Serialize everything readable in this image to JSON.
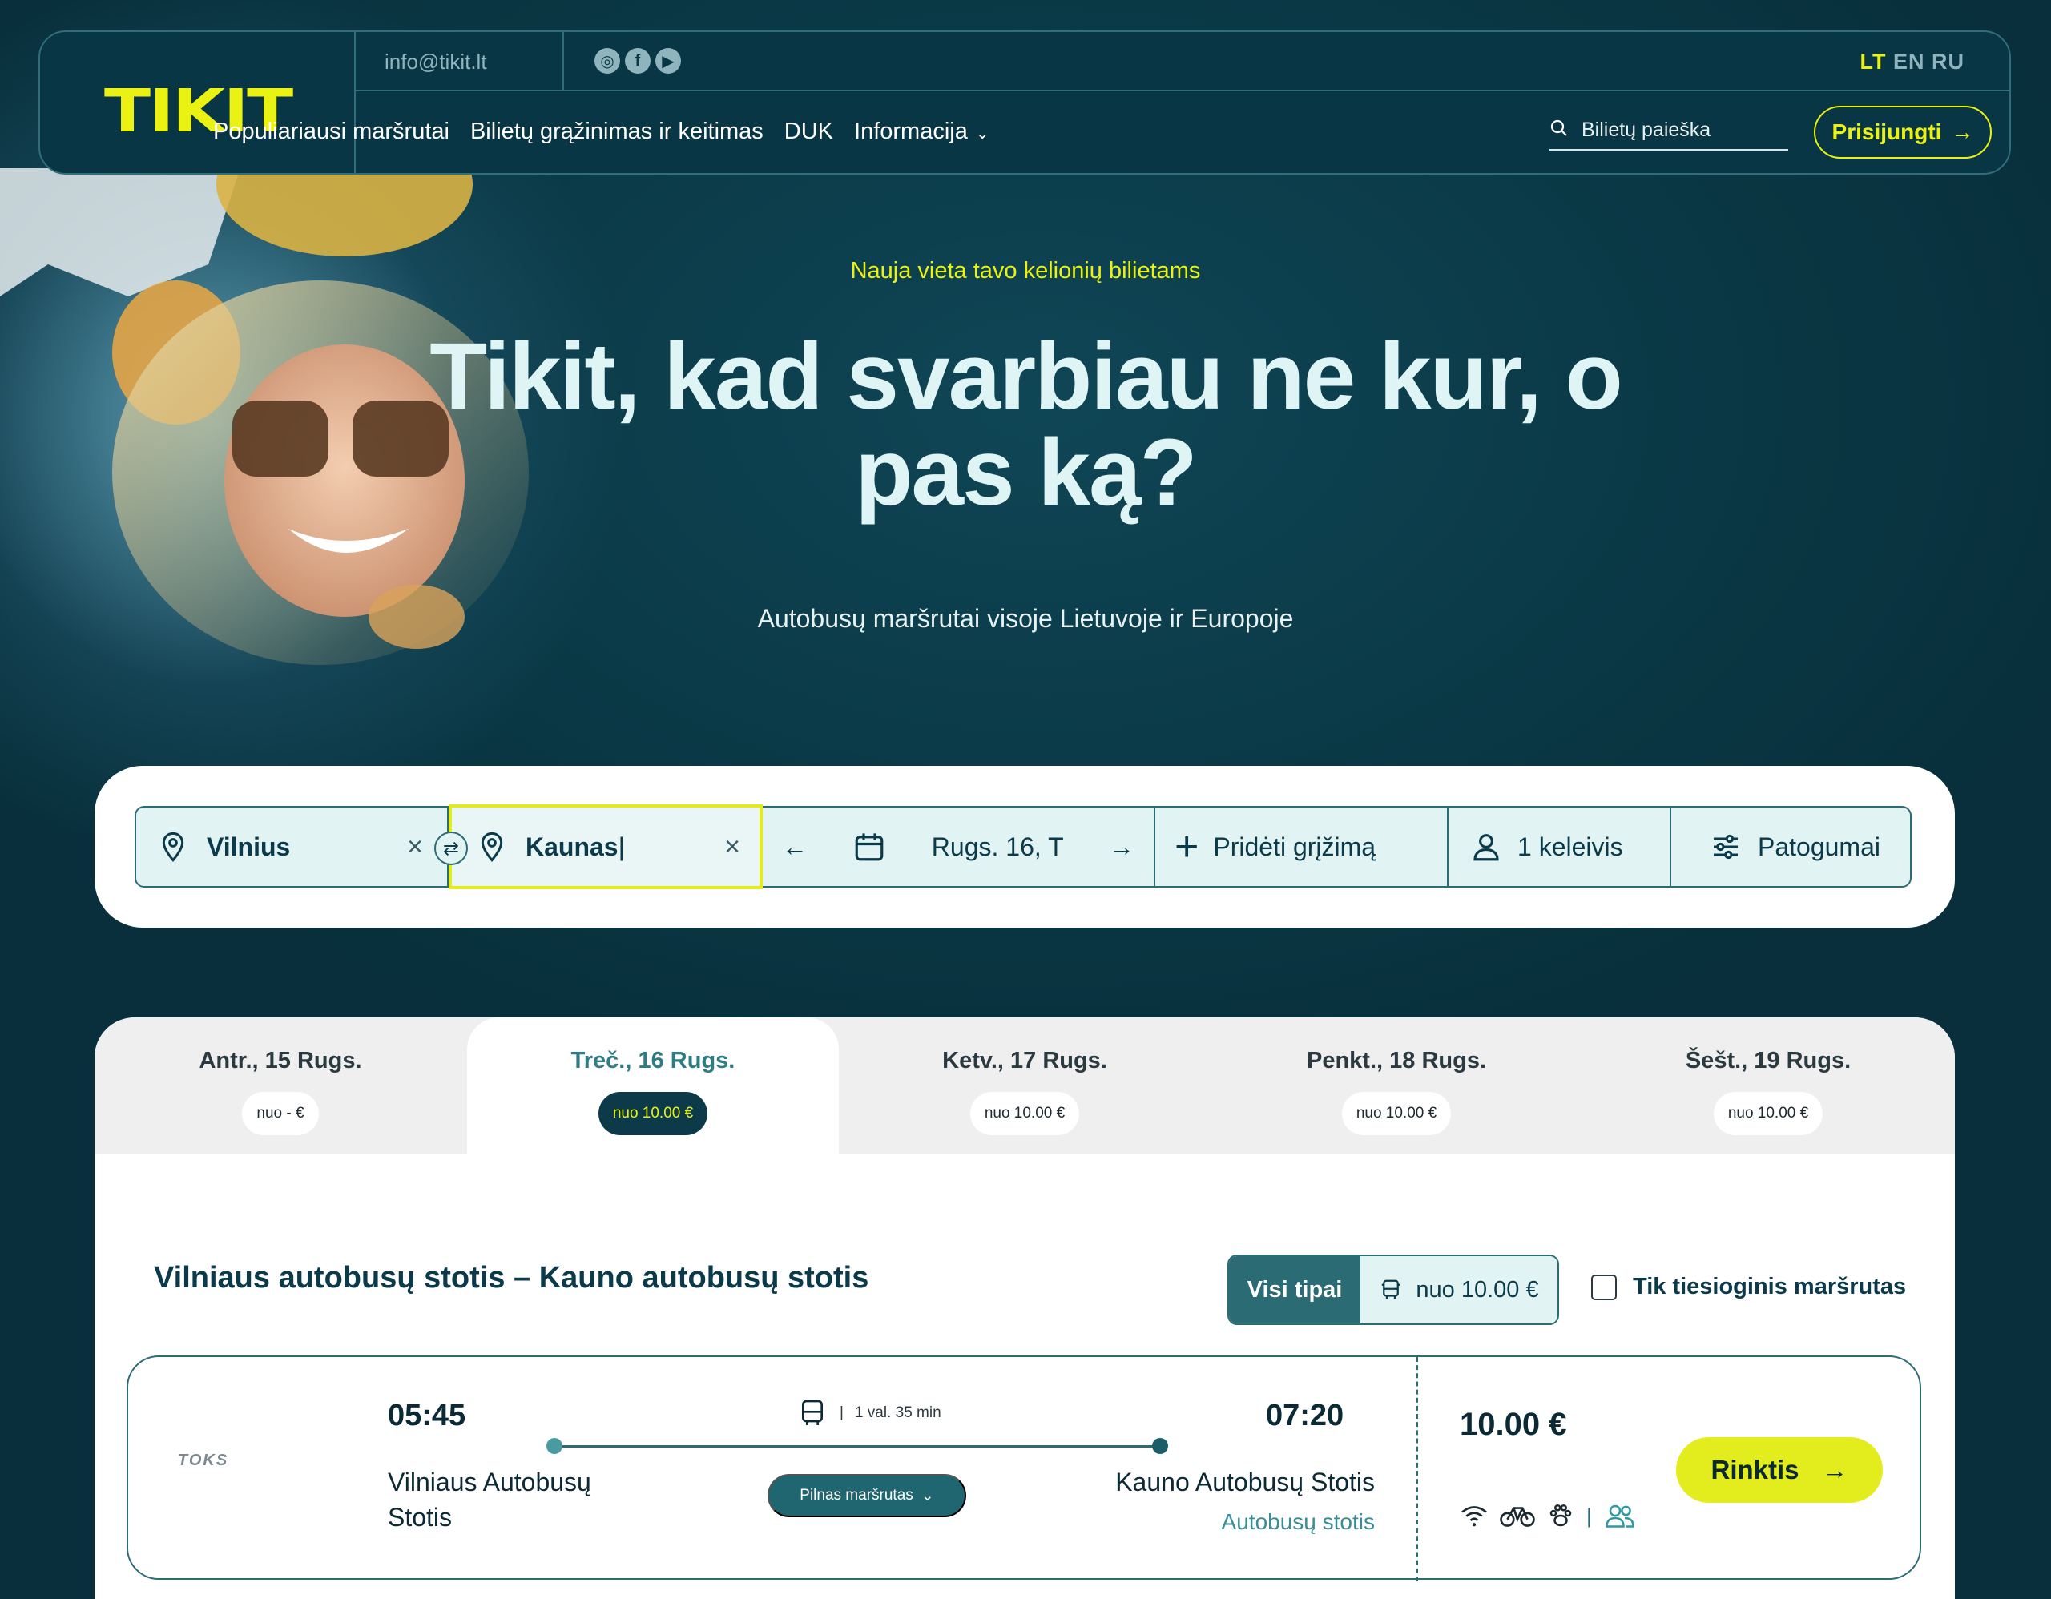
{
  "header": {
    "logo": "TIKIT",
    "email": "info@tikit.lt",
    "social_icons": [
      "instagram-icon",
      "facebook-icon",
      "youtube-icon"
    ],
    "languages": [
      {
        "label": "LT",
        "active": true
      },
      {
        "label": "EN",
        "active": false
      },
      {
        "label": "RU",
        "active": false
      }
    ],
    "nav": [
      {
        "label": "Populiariausi maršrutai"
      },
      {
        "label": "Bilietų grąžinimas ir keitimas"
      },
      {
        "label": "DUK"
      },
      {
        "label": "Informacija"
      }
    ],
    "search_placeholder": "Bilietų paieška",
    "login_label": "Prisijungti"
  },
  "hero": {
    "tagline": "Nauja vieta tavo kelionių bilietams",
    "headline": "Tikit, kad svarbiau ne kur, o pas ką?",
    "subline": "Autobusų maršrutai visoje Lietuvoje ir Europoje"
  },
  "search": {
    "from": "Vilnius",
    "to": "Kaunas",
    "date": "Rugs. 16, T",
    "add_return": "Pridėti grįžimą",
    "passengers": "1 keleivis",
    "amenities": "Patogumai"
  },
  "date_tabs": [
    {
      "date": "Antr., 15 Rugs.",
      "price": "nuo - €",
      "active": false
    },
    {
      "date": "Treč., 16 Rugs.",
      "price": "nuo 10.00 €",
      "active": true
    },
    {
      "date": "Ketv., 17 Rugs.",
      "price": "nuo 10.00 €",
      "active": false
    },
    {
      "date": "Penkt., 18 Rugs.",
      "price": "nuo 10.00 €",
      "active": false
    },
    {
      "date": "Šešt., 19 Rugs.",
      "price": "nuo 10.00 €",
      "active": false
    }
  ],
  "results": {
    "route_title": "Vilniaus autobusų stotis – Kauno autobusų stotis",
    "all_types": "Visi tipai",
    "bus_price": "nuo 10.00 €",
    "direct_only": "Tik tiesioginis maršrutas",
    "trip": {
      "operator": "TOKS",
      "departure_time": "05:45",
      "arrival_time": "07:20",
      "duration": "1 val. 35 min",
      "departure_stop": "Vilniaus Autobusų Stotis",
      "arrival_stop": "Kauno Autobusų Stotis",
      "arrival_type": "Autobusų stotis",
      "full_route": "Pilnas maršrutas",
      "price": "10.00 €",
      "amenities": [
        "wifi-icon",
        "bicycle-icon",
        "pet-icon",
        "passengers-icon"
      ],
      "choose_label": "Rinktis"
    }
  },
  "colors": {
    "brand_yellow": "#e9f213",
    "dark_teal": "#0a3845",
    "accent_teal": "#2c6c74"
  }
}
